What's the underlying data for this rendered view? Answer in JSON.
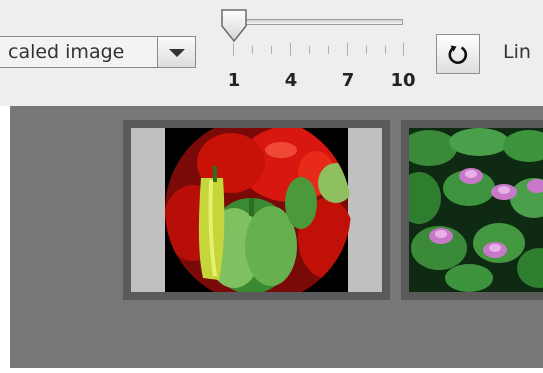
{
  "toolbar": {
    "scale_combo_value": "caled image",
    "slider": {
      "min": 1,
      "max": 10,
      "value": 1,
      "tick_labels": [
        "1",
        "4",
        "7",
        "10"
      ]
    },
    "refresh_icon": "refresh-icon",
    "link_label": "Lin"
  },
  "thumbnails": [
    {
      "subject": "peppers",
      "selected": true
    },
    {
      "subject": "water lilies",
      "selected": false
    }
  ],
  "colors": {
    "toolbar_bg": "#eeeeee",
    "content_bg": "#777777",
    "thumb_frame": "#5a5a5a",
    "thumb_matte": "#c0c0c0"
  }
}
